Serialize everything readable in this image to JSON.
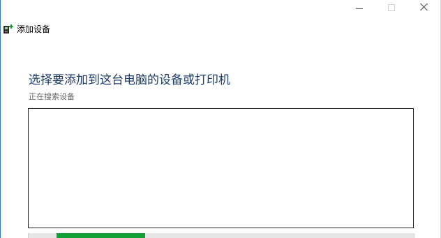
{
  "window": {
    "title": "添加设备",
    "caption_buttons": [
      "minimize-icon",
      "maximize-icon",
      "close-icon"
    ]
  },
  "main": {
    "heading": "选择要添加到这台电脑的设备或打印机",
    "status": "正在搜索设备"
  },
  "device_list": {
    "items": []
  },
  "progress": {
    "state": "indeterminate",
    "color": "#13a136"
  },
  "colors": {
    "heading": "#1a3b6b",
    "accent_border": "#2b79d8"
  }
}
